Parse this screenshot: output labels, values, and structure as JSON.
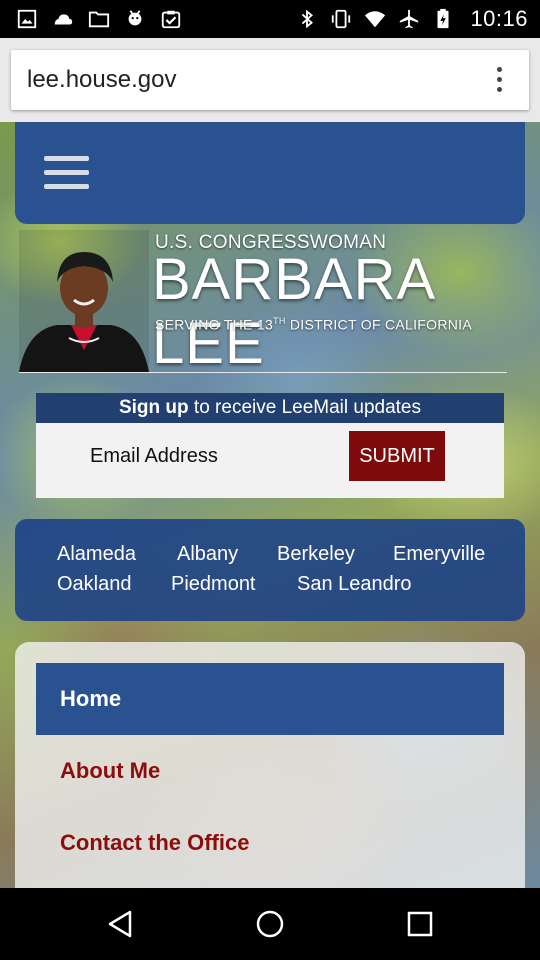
{
  "status_bar": {
    "time": "10:16",
    "icons_left": [
      "image-icon",
      "cloud-icon",
      "folder-icon",
      "android-icon",
      "clipboard-check-icon"
    ],
    "icons_right": [
      "bluetooth-icon",
      "vibrate-icon",
      "wifi-icon",
      "airplane-icon",
      "battery-icon"
    ]
  },
  "browser": {
    "url": "lee.house.gov"
  },
  "banner": {
    "title_small": "U.S. CONGRESSWOMAN",
    "title_big": "BARBARA LEE",
    "title_sub_prefix": "SERVING THE 13",
    "title_sub_sup": "TH",
    "title_sub_suffix": " DISTRICT OF CALIFORNIA"
  },
  "signup": {
    "heading_bold": "Sign up",
    "heading_rest": " to receive LeeMail updates",
    "email_label": "Email Address",
    "submit_label": "SUBMIT"
  },
  "cities": [
    "Alameda",
    "Albany",
    "Berkeley",
    "Emeryville",
    "Oakland",
    "Piedmont",
    "San Leandro"
  ],
  "nav": {
    "home": "Home",
    "items": [
      "About Me",
      "Contact the Office"
    ]
  },
  "colors": {
    "header_blue": "#2a5190",
    "submit_red": "#7e0b0b",
    "link_red": "#8b0d0d"
  }
}
